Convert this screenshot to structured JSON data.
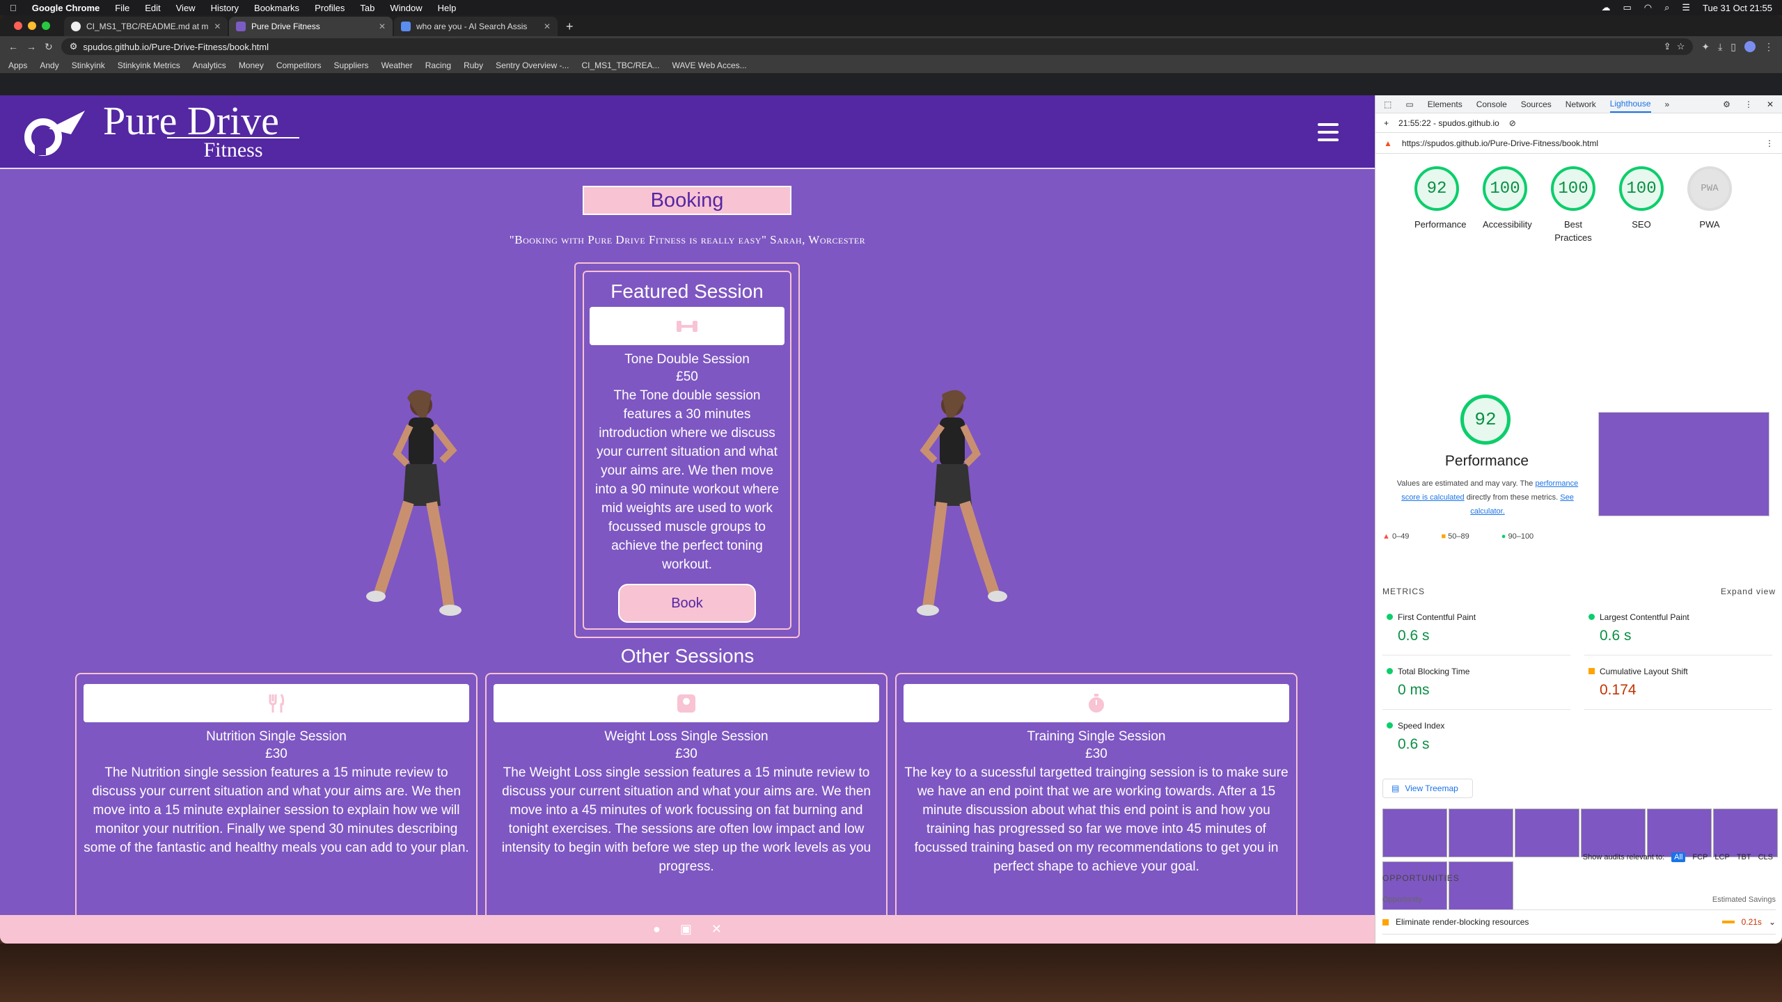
{
  "menubar": {
    "apple": "",
    "app": "Google Chrome",
    "items": [
      "File",
      "Edit",
      "View",
      "History",
      "Bookmarks",
      "Profiles",
      "Tab",
      "Window",
      "Help"
    ],
    "clock": "Tue 31 Oct  21:55"
  },
  "browser": {
    "tabs": [
      {
        "title": "CI_MS1_TBC/README.md at m"
      },
      {
        "title": "Pure Drive Fitness"
      },
      {
        "title": "who are you - AI Search Assis"
      }
    ],
    "url": "spudos.github.io/Pure-Drive-Fitness/book.html",
    "bookmarks": [
      "Apps",
      "Andy",
      "Stinkyink",
      "Stinkyink Metrics",
      "Analytics",
      "Money",
      "Competitors",
      "Suppliers",
      "Weather",
      "Racing",
      "Ruby",
      "Sentry Overview -...",
      "CI_MS1_TBC/REA...",
      "WAVE Web Acces..."
    ]
  },
  "site": {
    "logo_title": "Pure Drive",
    "logo_sub": "Fitness",
    "heading": "Booking",
    "quote": "\"Booking with Pure Drive Fitness is really easy\" Sarah, Worcester",
    "featured": {
      "title": "Featured Session",
      "name": "Tone Double Session",
      "price": "£50",
      "desc": "The Tone double session features a 30 minutes introduction where we discuss your current situation and what your aims are. We then move into a 90 minute workout where mid weights are used to work focussed muscle groups to achieve the perfect toning workout.",
      "button": "Book"
    },
    "other_title": "Other Sessions",
    "others": [
      {
        "name": "Nutrition Single Session",
        "price": "£30",
        "desc": "The Nutrition single session features a 15 minute review to discuss your current situation and what your aims are. We then move into a 15 minute explainer session to explain how we will monitor your nutrition. Finally we spend 30 minutes describing some of the fantastic and healthy meals you can add to your plan."
      },
      {
        "name": "Weight Loss Single Session",
        "price": "£30",
        "desc": "The Weight Loss single session features a 15 minute review to discuss your current situation and what your aims are. We then move into a 45 minutes of work focussing on fat burning and tonight exercises. The sessions are often low impact and low intensity to begin with before we step up the work levels as you progress."
      },
      {
        "name": "Training Single Session",
        "price": "£30",
        "desc": "The key to a sucessful targetted trainging session is to make sure we have an end point that we are working towards. After a 15 minute discussion about what this end point is and how you training has progressed so far we move into 45 minutes of focussed training based on my recommendations to get you in perfect shape to achieve your goal."
      }
    ],
    "footer_icons": [
      "facebook-icon",
      "instagram-icon",
      "x-icon"
    ],
    "brand_purple": "#7e57c2",
    "brand_pink": "#f8c3d3"
  },
  "devtools": {
    "tabs": [
      "Elements",
      "Console",
      "Sources",
      "Network",
      "Lighthouse"
    ],
    "report_time": "21:55:22 - spudos.github.io",
    "report_url": "https://spudos.github.io/Pure-Drive-Fitness/book.html",
    "scores": [
      {
        "label": "Performance",
        "value": "92"
      },
      {
        "label": "Accessibility",
        "value": "100"
      },
      {
        "label": "Best Practices",
        "value": "100"
      },
      {
        "label": "SEO",
        "value": "100"
      },
      {
        "label": "PWA",
        "value": "PWA"
      }
    ],
    "perf_score": "92",
    "perf_title": "Performance",
    "perf_note_1": "Values are estimated and may vary. The",
    "perf_note_link": "performance score is calculated",
    "perf_note_2": "directly from these metrics.",
    "perf_note_calc": "See calculator.",
    "legend": [
      "0–49",
      "50–89",
      "90–100"
    ],
    "metrics_label": "METRICS",
    "expand_view": "Expand view",
    "metrics": [
      {
        "name": "First Contentful Paint",
        "value": "0.6 s"
      },
      {
        "name": "Largest Contentful Paint",
        "value": "0.6 s"
      },
      {
        "name": "Total Blocking Time",
        "value": "0 ms"
      },
      {
        "name": "Cumulative Layout Shift",
        "value": "0.174"
      },
      {
        "name": "Speed Index",
        "value": "0.6 s"
      }
    ],
    "treemap": "View Treemap",
    "audits_relevant": "Show audits relevant to:",
    "audit_filters": [
      "All",
      "FCP",
      "LCP",
      "TBT",
      "CLS"
    ],
    "opportunities": "OPPORTUNITIES",
    "opp_col1": "Opportunity",
    "opp_col2": "Estimated Savings",
    "opp_item": "Eliminate render-blocking resources",
    "opp_savings": "0.21s"
  }
}
